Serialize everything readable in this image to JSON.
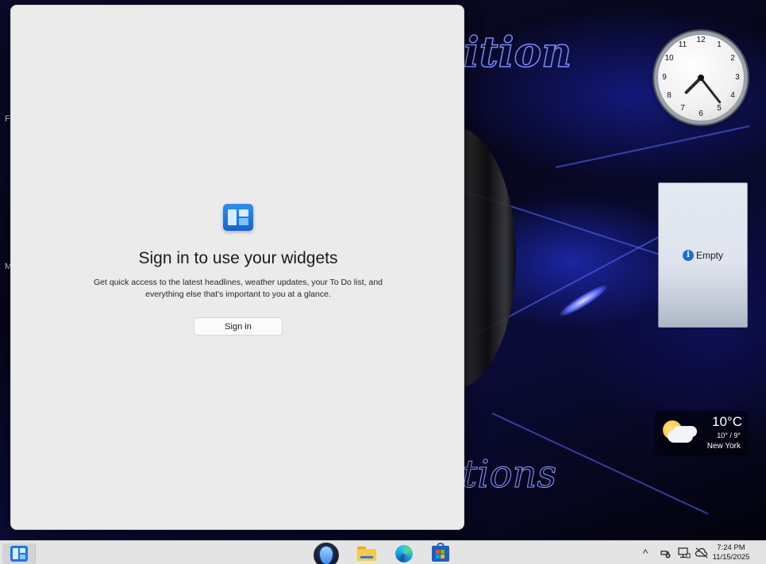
{
  "widgets_panel": {
    "title": "Sign in to use your widgets",
    "description": "Get quick access to the latest headlines, weather updates, your To Do list, and everything else that's important to you at a glance.",
    "sign_in_label": "Sign in",
    "icon": "widgets-board-icon"
  },
  "desktop": {
    "wallpaper_text_top": "ition",
    "wallpaper_text_bottom": "tions",
    "edge_letter_1": "F",
    "edge_letter_2": "M"
  },
  "gadgets": {
    "clock": {
      "numbers": [
        "12",
        "1",
        "2",
        "3",
        "4",
        "5",
        "6",
        "7",
        "8",
        "9",
        "10",
        "11"
      ]
    },
    "empty_gadget": {
      "label": "Empty",
      "icon": "info-icon"
    },
    "weather": {
      "temperature": "10°C",
      "range": "10° / 9°",
      "location": "New York",
      "icon": "partly-cloudy-icon"
    }
  },
  "taskbar": {
    "items": [
      {
        "name": "widgets",
        "icon": "widgets-icon"
      },
      {
        "name": "start",
        "icon": "alien-start-icon"
      },
      {
        "name": "file-explorer",
        "icon": "folder-icon"
      },
      {
        "name": "edge",
        "icon": "edge-browser-icon"
      },
      {
        "name": "store",
        "icon": "store-icon"
      }
    ],
    "tray": {
      "chevron": "^",
      "time": "7:24 PM",
      "date": "11/15/2025"
    }
  }
}
